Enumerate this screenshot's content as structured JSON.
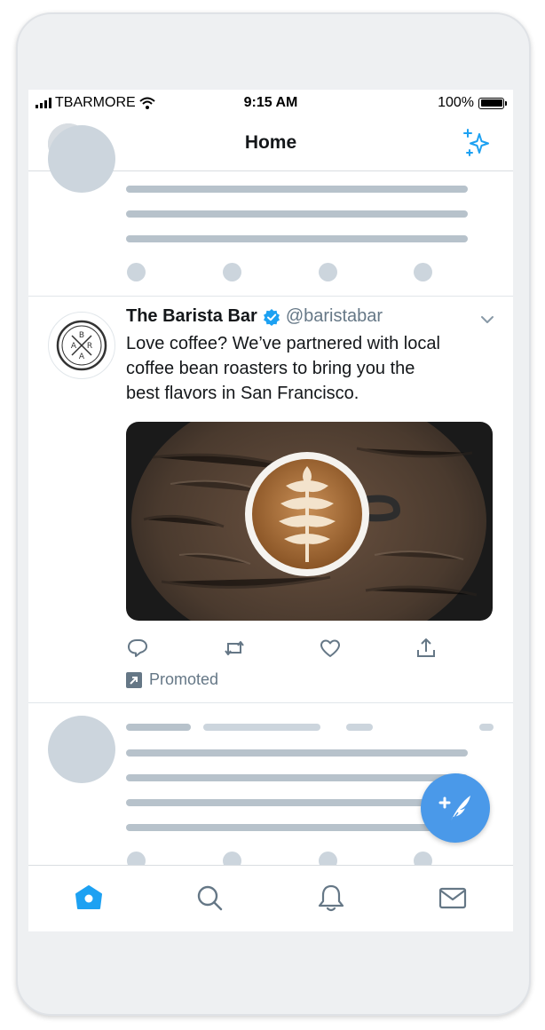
{
  "status_bar": {
    "carrier": "TBARMORE",
    "time": "9:15 AM",
    "battery": "100%"
  },
  "header": {
    "title": "Home"
  },
  "promoted_tweet": {
    "name": "The Barista Bar",
    "handle": "@baristabar",
    "text_lines": [
      "Love coffee? We’ve partnered with local",
      "coffee bean roasters to bring you the",
      "best flavors in San Francisco."
    ],
    "logo_letters": [
      "B",
      "A",
      "R",
      "A"
    ],
    "promoted_label": "Promoted"
  },
  "icons": {
    "sparkle": "sparkle-icon",
    "verified": "verified-badge-icon",
    "reply": "reply-icon",
    "retweet": "retweet-icon",
    "like": "like-icon",
    "share": "share-icon",
    "compose": "compose-tweet-icon",
    "tabs": [
      "home-icon",
      "search-icon",
      "notifications-icon",
      "messages-icon"
    ]
  },
  "colors": {
    "accent": "#1da1f2",
    "fab": "#4a99e9",
    "secondary_text": "#657786",
    "skeleton": "#ccd5dd"
  }
}
